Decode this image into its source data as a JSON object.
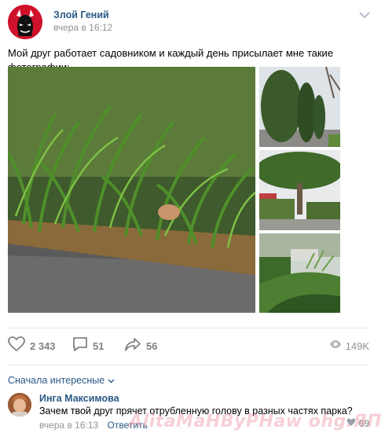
{
  "post": {
    "author": "Злой Гений",
    "time": "вчера в 16:12",
    "text": "Мой друг работает садовником и каждый день присылает мне такие фотографии:"
  },
  "actions": {
    "likes": "2 343",
    "comments": "51",
    "shares": "56",
    "views": "149K"
  },
  "comments_section": {
    "sort_label": "Сначала интересные",
    "items": [
      {
        "author": "Инга Максимова",
        "text": "Зачем твой друг прячет отрубленную голову в разных частях парка?",
        "time": "вчера в 16:13",
        "reply_label": "Ответить",
        "likes": "69"
      }
    ]
  },
  "watermark": "AlitaMaHByPHaw ohg.ЯП",
  "colors": {
    "link": "#2a5885",
    "muted": "#939393",
    "icon": "#828282",
    "avatar_red": "#c8102e"
  },
  "icons": [
    "chevron-down-icon",
    "heart-icon",
    "comment-icon",
    "share-icon",
    "eye-icon"
  ]
}
